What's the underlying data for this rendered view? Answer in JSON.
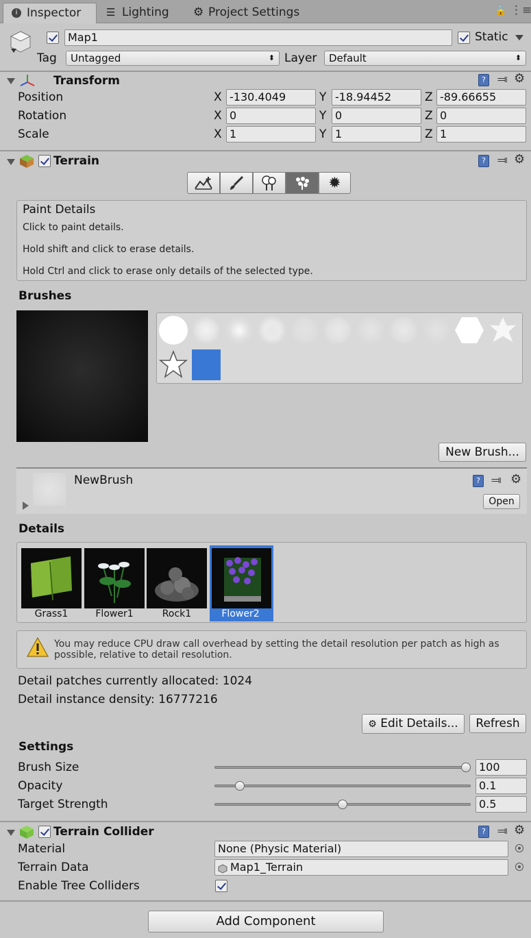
{
  "tabs": {
    "inspector": "Inspector",
    "lighting": "Lighting",
    "project_settings": "Project Settings"
  },
  "object": {
    "name": "Map1",
    "static_label": "Static",
    "tag_label": "Tag",
    "tag_value": "Untagged",
    "layer_label": "Layer",
    "layer_value": "Default"
  },
  "transform": {
    "title": "Transform",
    "position_label": "Position",
    "rotation_label": "Rotation",
    "scale_label": "Scale",
    "axis_x": "X",
    "axis_y": "Y",
    "axis_z": "Z",
    "position": {
      "x": "-130.4049",
      "y": "-18.94452",
      "z": "-89.66655"
    },
    "rotation": {
      "x": "0",
      "y": "0",
      "z": "0"
    },
    "scale": {
      "x": "1",
      "y": "1",
      "z": "1"
    }
  },
  "terrain": {
    "title": "Terrain",
    "help_title": "Paint Details",
    "help_lines": [
      "Click to paint details.",
      "Hold shift and click to erase details.",
      "Hold Ctrl and click to erase only details of the selected type."
    ],
    "brushes_label": "Brushes",
    "new_brush_button": "New Brush...",
    "brush_name": "NewBrush",
    "open_button": "Open",
    "details_label": "Details",
    "details": [
      "Grass1",
      "Flower1",
      "Rock1",
      "Flower2"
    ],
    "warning": "You may reduce CPU draw call overhead by setting the detail resolution per patch as high as possible, relative to detail resolution.",
    "patches_text": "Detail patches currently allocated: 1024",
    "density_text": "Detail instance density: 16777216",
    "edit_details_button": "Edit Details...",
    "refresh_button": "Refresh",
    "settings_label": "Settings",
    "brush_size_label": "Brush Size",
    "brush_size_value": "100",
    "brush_size_fraction": 0.98,
    "opacity_label": "Opacity",
    "opacity_value": "0.1",
    "opacity_fraction": 0.1,
    "target_strength_label": "Target Strength",
    "target_strength_value": "0.5",
    "target_strength_fraction": 0.5
  },
  "collider": {
    "title": "Terrain Collider",
    "material_label": "Material",
    "material_value": "None (Physic Material)",
    "terrain_data_label": "Terrain Data",
    "terrain_data_value": "Map1_Terrain",
    "tree_colliders_label": "Enable Tree Colliders"
  },
  "add_component_button": "Add Component",
  "colors": {
    "selection": "#3a78d6",
    "panel": "#c8c8c8"
  }
}
